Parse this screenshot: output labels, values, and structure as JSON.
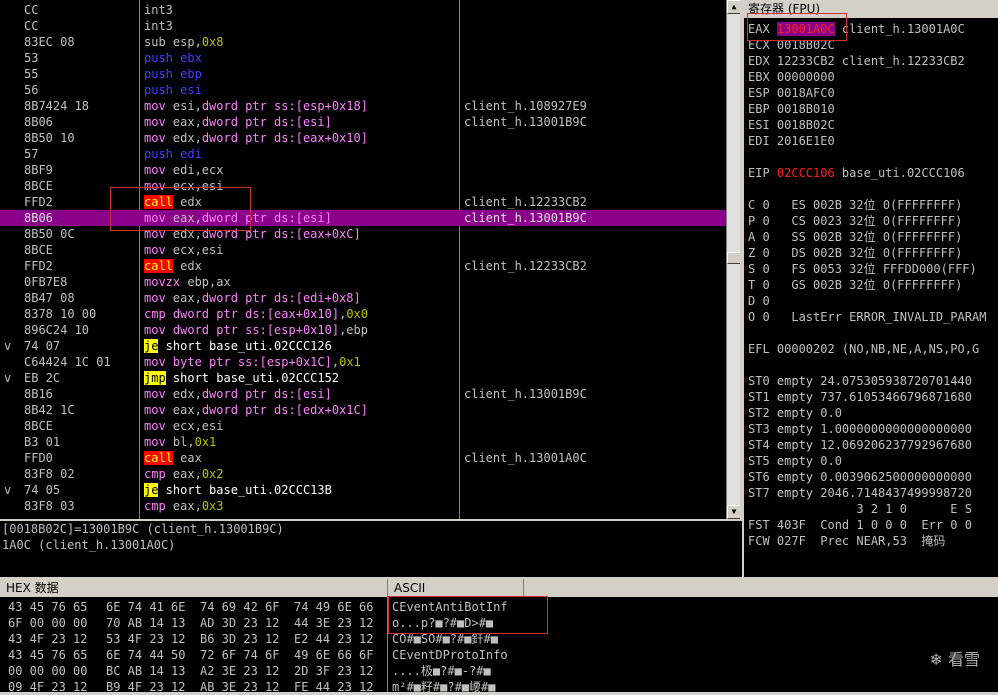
{
  "disasm_rows": [
    {
      "mark": "",
      "bytes": "CC",
      "ins": [
        [
          "def",
          "int3"
        ]
      ],
      "cmt": ""
    },
    {
      "mark": "",
      "bytes": "CC",
      "ins": [
        [
          "def",
          "int3"
        ]
      ],
      "cmt": ""
    },
    {
      "mark": "",
      "bytes": "83EC 08",
      "ins": [
        [
          "def",
          "sub "
        ],
        [
          "def",
          "esp"
        ],
        [
          "def",
          ","
        ],
        [
          "num",
          "0x8"
        ]
      ],
      "cmt": ""
    },
    {
      "mark": "",
      "bytes": "53",
      "ins": [
        [
          "push",
          "push ebx"
        ]
      ],
      "cmt": ""
    },
    {
      "mark": "",
      "bytes": "55",
      "ins": [
        [
          "push",
          "push ebp"
        ]
      ],
      "cmt": ""
    },
    {
      "mark": "",
      "bytes": "56",
      "ins": [
        [
          "push",
          "push esi"
        ]
      ],
      "cmt": ""
    },
    {
      "mark": "",
      "bytes": "8B7424 18",
      "ins": [
        [
          "mov",
          "mov "
        ],
        [
          "def",
          "esi,"
        ],
        [
          "mov",
          "dword ptr ss:[esp+0x18]"
        ]
      ],
      "cmt": "client_h.108927E9"
    },
    {
      "mark": "",
      "bytes": "8B06",
      "ins": [
        [
          "mov",
          "mov "
        ],
        [
          "def",
          "eax,"
        ],
        [
          "mov",
          "dword ptr ds:[esi]"
        ]
      ],
      "cmt": "client_h.13001B9C"
    },
    {
      "mark": "",
      "bytes": "8B50 10",
      "ins": [
        [
          "mov",
          "mov "
        ],
        [
          "def",
          "edx,"
        ],
        [
          "mov",
          "dword ptr ds:[eax+0x10]"
        ]
      ],
      "cmt": ""
    },
    {
      "mark": "",
      "bytes": "57",
      "ins": [
        [
          "push",
          "push edi"
        ]
      ],
      "cmt": ""
    },
    {
      "mark": "",
      "bytes": "8BF9",
      "ins": [
        [
          "mov",
          "mov "
        ],
        [
          "def",
          "edi,ecx"
        ]
      ],
      "cmt": ""
    },
    {
      "mark": "",
      "bytes": "8BCE",
      "ins": [
        [
          "mov",
          "mov "
        ],
        [
          "def",
          "ecx,esi"
        ]
      ],
      "cmt": ""
    },
    {
      "mark": "",
      "bytes": "FFD2",
      "ins": [
        [
          "call",
          "call"
        ],
        [
          "def",
          " edx"
        ]
      ],
      "cmt": "client_h.12233CB2"
    },
    {
      "mark": "",
      "bytes": "8B06",
      "ins": [
        [
          "mov",
          "mov "
        ],
        [
          "def",
          "eax,"
        ],
        [
          "mov",
          "dword ptr ds:[esi]"
        ]
      ],
      "cmt": "client_h.13001B9C",
      "sel": true
    },
    {
      "mark": "",
      "bytes": "8B50 0C",
      "ins": [
        [
          "mov",
          "mov "
        ],
        [
          "def",
          "edx,"
        ],
        [
          "mov",
          "dword ptr ds:[eax+0xC]"
        ]
      ],
      "cmt": ""
    },
    {
      "mark": "",
      "bytes": "8BCE",
      "ins": [
        [
          "mov",
          "mov "
        ],
        [
          "def",
          "ecx,esi"
        ]
      ],
      "cmt": ""
    },
    {
      "mark": "",
      "bytes": "FFD2",
      "ins": [
        [
          "call",
          "call"
        ],
        [
          "def",
          " edx"
        ]
      ],
      "cmt": "client_h.12233CB2"
    },
    {
      "mark": "",
      "bytes": "0FB7E8",
      "ins": [
        [
          "mov",
          "movzx "
        ],
        [
          "def",
          "ebp,ax"
        ]
      ],
      "cmt": ""
    },
    {
      "mark": "",
      "bytes": "8B47 08",
      "ins": [
        [
          "mov",
          "mov "
        ],
        [
          "def",
          "eax,"
        ],
        [
          "mov",
          "dword ptr ds:[edi+0x8]"
        ]
      ],
      "cmt": ""
    },
    {
      "mark": "",
      "bytes": "8378 10 00",
      "ins": [
        [
          "mov",
          "cmp "
        ],
        [
          "mov",
          "dword ptr ds:[eax+0x10]"
        ],
        [
          "def",
          ","
        ],
        [
          "num",
          "0x0"
        ]
      ],
      "cmt": ""
    },
    {
      "mark": "",
      "bytes": "896C24 10",
      "ins": [
        [
          "mov",
          "mov "
        ],
        [
          "mov",
          "dword ptr ss:[esp+0x10]"
        ],
        [
          "def",
          ",ebp"
        ]
      ],
      "cmt": ""
    },
    {
      "mark": "v",
      "bytes": "74 07",
      "ins": [
        [
          "jcc",
          "je"
        ],
        [
          "white",
          " short base_uti.02CCC126"
        ]
      ],
      "cmt": ""
    },
    {
      "mark": "",
      "bytes": "C64424 1C 01",
      "ins": [
        [
          "mov",
          "mov "
        ],
        [
          "mov",
          "byte ptr ss:[esp+0x1C]"
        ],
        [
          "def",
          ","
        ],
        [
          "num",
          "0x1"
        ]
      ],
      "cmt": ""
    },
    {
      "mark": "v",
      "bytes": "EB 2C",
      "ins": [
        [
          "jcc",
          "jmp"
        ],
        [
          "white",
          " short base_uti.02CCC152"
        ]
      ],
      "cmt": ""
    },
    {
      "mark": "",
      "bytes": "8B16",
      "ins": [
        [
          "mov",
          "mov "
        ],
        [
          "def",
          "edx,"
        ],
        [
          "mov",
          "dword ptr ds:[esi]"
        ]
      ],
      "cmt": "client_h.13001B9C"
    },
    {
      "mark": "",
      "bytes": "8B42 1C",
      "ins": [
        [
          "mov",
          "mov "
        ],
        [
          "def",
          "eax,"
        ],
        [
          "mov",
          "dword ptr ds:[edx+0x1C]"
        ]
      ],
      "cmt": ""
    },
    {
      "mark": "",
      "bytes": "8BCE",
      "ins": [
        [
          "mov",
          "mov "
        ],
        [
          "def",
          "ecx,esi"
        ]
      ],
      "cmt": ""
    },
    {
      "mark": "",
      "bytes": "B3 01",
      "ins": [
        [
          "mov",
          "mov "
        ],
        [
          "def",
          "bl,"
        ],
        [
          "num",
          "0x1"
        ]
      ],
      "cmt": ""
    },
    {
      "mark": "",
      "bytes": "FFD0",
      "ins": [
        [
          "call",
          "call"
        ],
        [
          "def",
          " eax"
        ]
      ],
      "cmt": "client_h.13001A0C"
    },
    {
      "mark": "",
      "bytes": "83F8 02",
      "ins": [
        [
          "mov",
          "cmp "
        ],
        [
          "def",
          "eax,"
        ],
        [
          "num",
          "0x2"
        ]
      ],
      "cmt": ""
    },
    {
      "mark": "v",
      "bytes": "74 05",
      "ins": [
        [
          "jcc",
          "je"
        ],
        [
          "white",
          " short base_uti.02CCC13B"
        ]
      ],
      "cmt": ""
    },
    {
      "mark": "",
      "bytes": "83F8 03",
      "ins": [
        [
          "mov",
          "cmp "
        ],
        [
          "def",
          "eax,"
        ],
        [
          "num",
          "0x3"
        ]
      ],
      "cmt": ""
    }
  ],
  "info_lines": [
    "[0018B02C]=13001B9C (client_h.13001B9C)",
    "1A0C (client_h.13001A0C)"
  ],
  "regs": {
    "title": "寄存器 (FPU)",
    "lines": [
      [
        "EAX ",
        "13001A0C",
        " client_h.13001A0C"
      ],
      [
        "ECX 0018B02C"
      ],
      [
        "EDX 12233CB2 client_h.12233CB2"
      ],
      [
        "EBX 00000000"
      ],
      [
        "ESP 0018AFC0"
      ],
      [
        "EBP 0018B010"
      ],
      [
        "ESI 0018B02C"
      ],
      [
        "EDI 2016E1E0"
      ],
      [
        ""
      ],
      [
        "EIP ",
        "02CCC106",
        " base_uti.02CCC106"
      ],
      [
        ""
      ],
      [
        "C 0   ES 002B 32位 0(FFFFFFFF)"
      ],
      [
        "P 0   CS 0023 32位 0(FFFFFFFF)"
      ],
      [
        "A 0   SS 002B 32位 0(FFFFFFFF)"
      ],
      [
        "Z 0   DS 002B 32位 0(FFFFFFFF)"
      ],
      [
        "S 0   FS 0053 32位 FFFDD000(FFF)"
      ],
      [
        "T 0   GS 002B 32位 0(FFFFFFFF)"
      ],
      [
        "D 0"
      ],
      [
        "O 0   LastErr ERROR_INVALID_PARAM"
      ],
      [
        ""
      ],
      [
        "EFL 00000202 (NO,NB,NE,A,NS,PO,G"
      ],
      [
        ""
      ],
      [
        "ST0 empty 24.075305938720701440"
      ],
      [
        "ST1 empty 737.61053466796871680"
      ],
      [
        "ST2 empty 0.0"
      ],
      [
        "ST3 empty 1.0000000000000000000"
      ],
      [
        "ST4 empty 12.069206237792967680"
      ],
      [
        "ST5 empty 0.0"
      ],
      [
        "ST6 empty 0.0039062500000000000"
      ],
      [
        "ST7 empty 2046.7148437499998720"
      ],
      [
        "               3 2 1 0      E S"
      ],
      [
        "FST 403F  Cond 1 0 0 0  Err 0 0"
      ],
      [
        "FCW 027F  Prec NEAR,53  掩码"
      ]
    ]
  },
  "hex": {
    "hex_header": "HEX 数据",
    "ascii_header": "ASCII",
    "rows": [
      [
        "43 45 76 65",
        "6E 74 41 6E",
        "74 69 42 6F",
        "74 49 6E 66",
        "CEventAntiBotInf"
      ],
      [
        "6F 00 00 00",
        "70 AB 14 13",
        "AD 3D 23 12",
        "44 3E 23 12",
        "o...p?■?#■D>#■"
      ],
      [
        "43 4F 23 12",
        "53 4F 23 12",
        "B6 3D 23 12",
        "E2 44 23 12",
        "CO#■SO#■?#■釬#■"
      ],
      [
        "43 45 76 65",
        "6E 74 44 50",
        "72 6F 74 6F",
        "49 6E 66 6F",
        "CEventDProtoInfo"
      ],
      [
        "00 00 00 00",
        "BC AB 14 13",
        "A2 3E 23 12",
        "2D 3F 23 12",
        "....极■?#■-?#■"
      ],
      [
        "09 4F 23 12",
        "B9 4F 23 12",
        "AB 3E 23 12",
        "FE 44 23 12",
        "m²#■籽#■?#■崾#■"
      ]
    ]
  },
  "watermark": "看雪"
}
